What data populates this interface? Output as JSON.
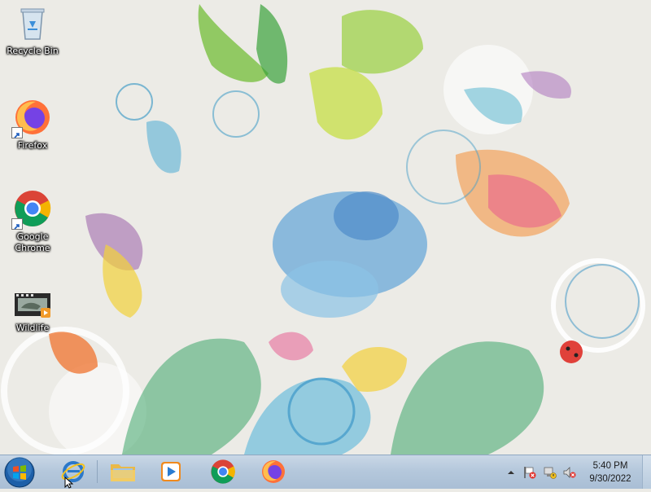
{
  "desktop": {
    "icons": [
      {
        "label": "Recycle Bin",
        "icon": "recycle-bin-icon"
      },
      {
        "label": "Firefox",
        "icon": "firefox-icon"
      },
      {
        "label": "Google Chrome",
        "icon": "chrome-icon"
      },
      {
        "label": "Wildlife",
        "icon": "video-file-icon"
      }
    ]
  },
  "taskbar": {
    "start_icon": "windows-logo-icon",
    "pinned": [
      {
        "name": "Internet Explorer",
        "icon": "internet-explorer-icon"
      },
      {
        "name": "Windows Explorer",
        "icon": "folder-icon"
      },
      {
        "name": "Windows Media Player",
        "icon": "media-player-icon"
      },
      {
        "name": "Google Chrome",
        "icon": "chrome-icon"
      },
      {
        "name": "Firefox",
        "icon": "firefox-icon"
      }
    ],
    "tray": {
      "icons": [
        "show-hidden-icons-arrow",
        "action-center-flag-icon",
        "network-icon",
        "volume-muted-icon"
      ],
      "time": "5:40 PM",
      "date": "9/30/2022"
    }
  },
  "colors": {
    "taskbar": "#b5c8dc",
    "desktop_bg": "#ecebe6",
    "chrome_red": "#db4437",
    "chrome_green": "#0f9d58",
    "chrome_yellow": "#f4b400",
    "chrome_blue": "#4285f4",
    "firefox_orange": "#ff7139",
    "firefox_purple": "#7542e5"
  }
}
